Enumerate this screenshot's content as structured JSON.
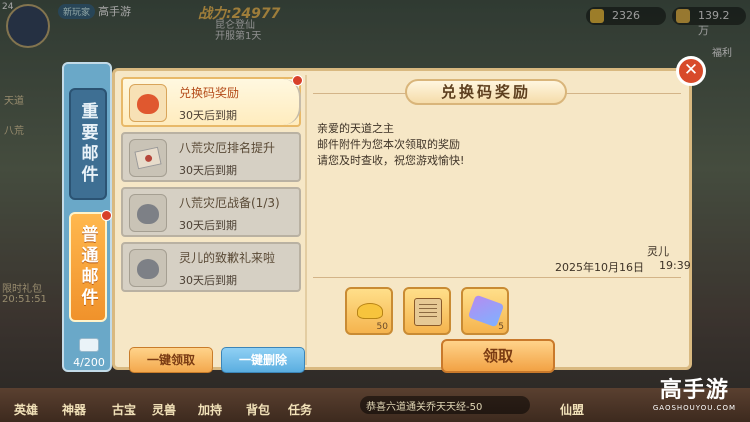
{
  "player": {
    "level": "24",
    "tag": "新玩家",
    "name": "高手游",
    "power": "战力:24977"
  },
  "event": {
    "name": "昆仑登仙",
    "sub": "开服第1天"
  },
  "resources": [
    {
      "value": "2326",
      "color": "#f0c040"
    },
    {
      "value": "139.2万",
      "color": "#e8b84a"
    }
  ],
  "side_labels": {
    "welfare": "福利",
    "limited": "限时礼包",
    "limited_time": "20:51:51",
    "left_a": "天道",
    "left_b": "八荒"
  },
  "tabs": {
    "important": "重要邮件",
    "normal": "普通邮件"
  },
  "mail_count": "4/200",
  "mails": [
    {
      "title": "兑换码奖励",
      "expire": "30天后到期",
      "icon": "red-bag-icon",
      "active": true
    },
    {
      "title": "八荒灾厄排名提升",
      "expire": "30天后到期",
      "icon": "envelope-icon",
      "active": false
    },
    {
      "title": "八荒灾厄战备(1/3)",
      "expire": "30天后到期",
      "icon": "gray-bag-icon",
      "active": false
    },
    {
      "title": "灵儿的致歉礼来啦",
      "expire": "30天后到期",
      "icon": "gray-bag-icon",
      "active": false
    }
  ],
  "buttons": {
    "receive_all": "一键领取",
    "delete_all": "一键删除",
    "claim": "领取"
  },
  "detail": {
    "heading": "兑换码奖励",
    "greeting": "亲爱的天道之主",
    "line1": "邮件附件为您本次领取的奖励",
    "line2": "请您及时查收，祝您游戏愉快!",
    "sender": "灵儿",
    "date": "2025年10月16日",
    "time": "19:39"
  },
  "rewards": [
    {
      "icon": "gold-ingot-icon",
      "qty": "50"
    },
    {
      "icon": "scroll-icon",
      "qty": ""
    },
    {
      "icon": "gem-fragment-icon",
      "qty": "5"
    }
  ],
  "bottom": {
    "nav": [
      "英雄",
      "神器",
      "古宝",
      "灵兽",
      "加持",
      "背包",
      "任务"
    ],
    "marquee": "恭喜六道通关乔天天经-50",
    "right": "仙盟"
  },
  "watermark": {
    "logo": "高手游",
    "url": "GAOSHOUYOU.COM"
  }
}
